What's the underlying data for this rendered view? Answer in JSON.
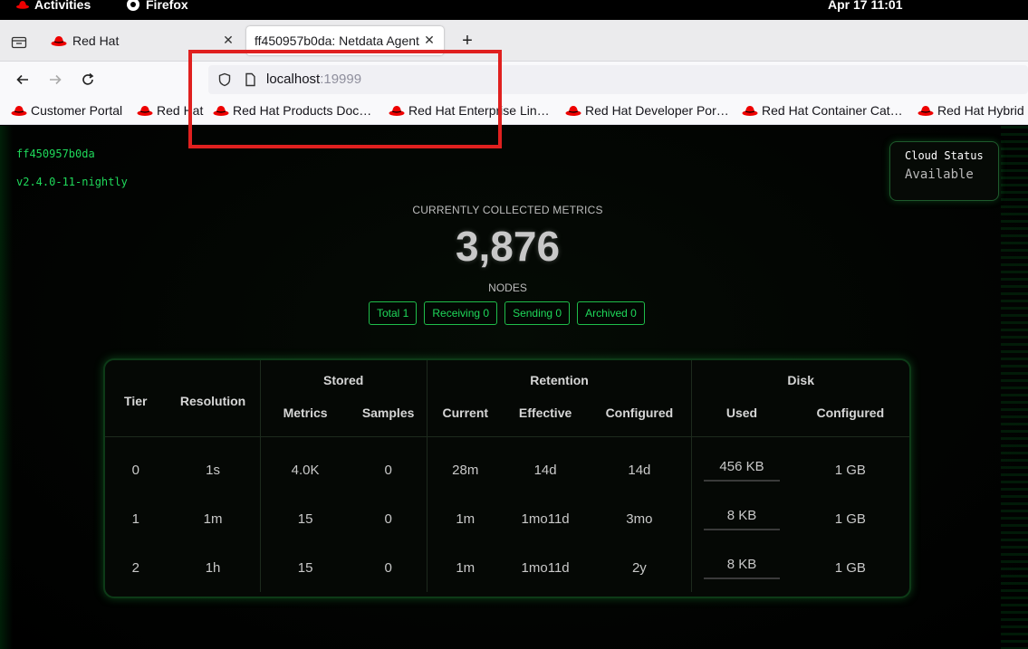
{
  "topbar": {
    "activities": "Activities",
    "app_name": "Firefox",
    "clock": "Apr 17  11:01"
  },
  "tabs": [
    {
      "title": "Red Hat",
      "active": false
    },
    {
      "title": "ff450957b0da: Netdata Agent",
      "active": true
    }
  ],
  "url": {
    "host": "localhost",
    "port": ":19999"
  },
  "bookmarks": [
    "Customer Portal",
    "Red Hat",
    "Red Hat Products Doc…",
    "Red Hat Enterprise Lin…",
    "Red Hat Developer Por…",
    "Red Hat Container Cat…",
    "Red Hat Hybrid"
  ],
  "agent": {
    "hostname": "ff450957b0da",
    "version": "v2.4.0-11-nightly"
  },
  "cloud": {
    "title": "Cloud Status",
    "value": "Available"
  },
  "metrics": {
    "label": "CURRENTLY COLLECTED METRICS",
    "value": "3,876",
    "nodes_label": "NODES",
    "badges": [
      "Total 1",
      "Receiving 0",
      "Sending 0",
      "Archived 0"
    ]
  },
  "tiers_table": {
    "headers": {
      "tier": "Tier",
      "resolution": "Resolution",
      "stored": "Stored",
      "retention": "Retention",
      "disk": "Disk",
      "metrics": "Metrics",
      "samples": "Samples",
      "current": "Current",
      "effective": "Effective",
      "configured": "Configured",
      "used": "Used",
      "disk_configured": "Configured"
    },
    "rows": [
      {
        "tier": "0",
        "resolution": "1s",
        "metrics": "4.0K",
        "samples": "0",
        "current": "28m",
        "effective": "14d",
        "configured": "14d",
        "used": "456 KB",
        "disk_configured": "1 GB"
      },
      {
        "tier": "1",
        "resolution": "1m",
        "metrics": "15",
        "samples": "0",
        "current": "1m",
        "effective": "1mo11d",
        "configured": "3mo",
        "used": "8 KB",
        "disk_configured": "1 GB"
      },
      {
        "tier": "2",
        "resolution": "1h",
        "metrics": "15",
        "samples": "0",
        "current": "1m",
        "effective": "1mo11d",
        "configured": "2y",
        "used": "8 KB",
        "disk_configured": "1 GB"
      }
    ]
  },
  "colors": {
    "accent_green": "#1fd85a",
    "annotation_red": "#e0201f"
  }
}
